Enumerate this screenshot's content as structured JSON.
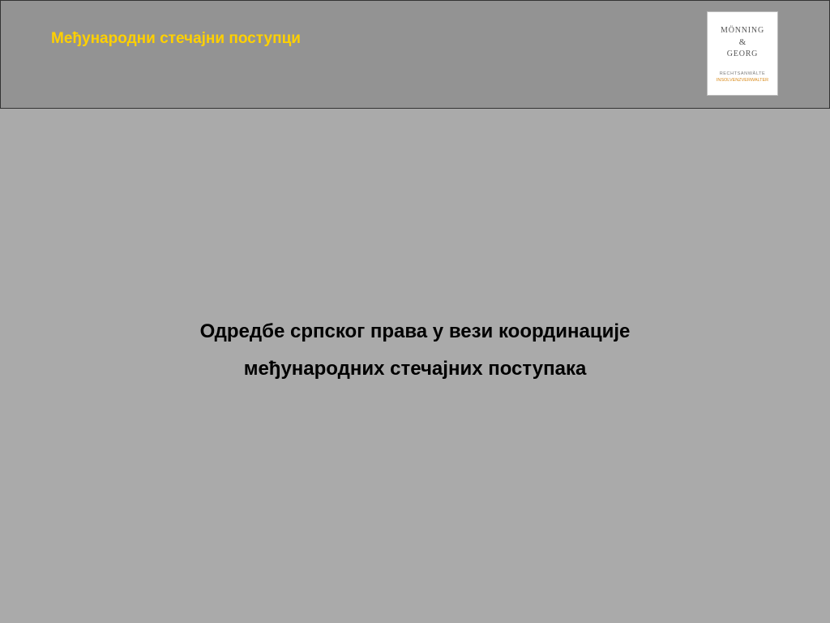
{
  "slide": {
    "header_title": "Међународни стечајни поступци",
    "logo": {
      "name_line1": "MÖNNING",
      "ampersand": "&",
      "name_line2": "GEORG",
      "subtitle_line1": "RECHTSANWÄLTE",
      "subtitle_line2": "INSOLVENZVERWALTER"
    },
    "main_text_line1": "Одредбе српског права у вези координације",
    "main_text_line2": "међународних стечајних поступака"
  },
  "colors": {
    "header_background": "#939393",
    "slide_background": "#aaaaaa",
    "title_color": "#ffd000",
    "logo_accent": "#d98a1a"
  }
}
